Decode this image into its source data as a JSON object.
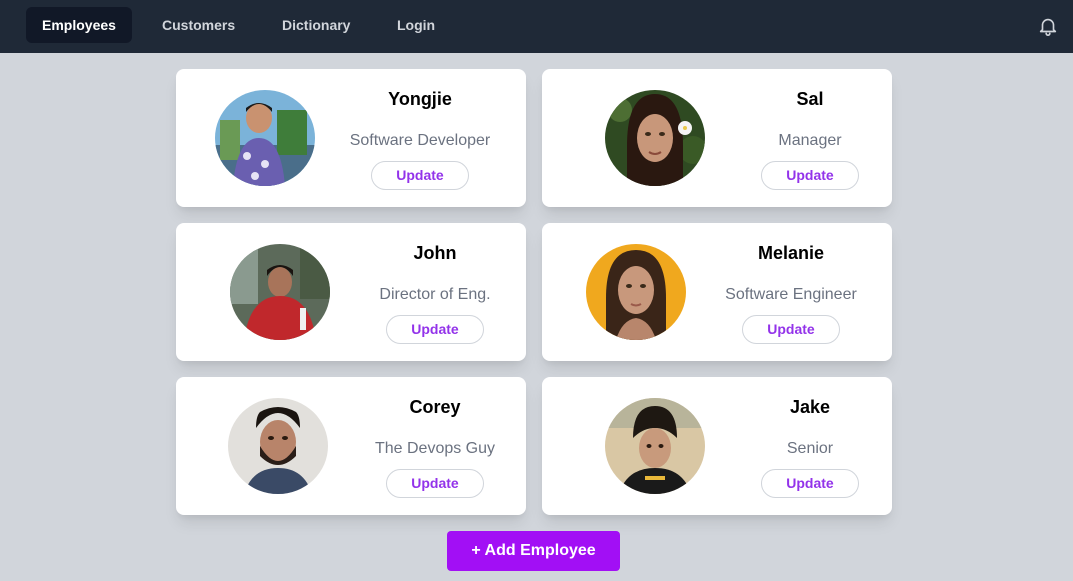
{
  "nav": {
    "items": [
      {
        "label": "Employees",
        "active": true
      },
      {
        "label": "Customers",
        "active": false
      },
      {
        "label": "Dictionary",
        "active": false
      },
      {
        "label": "Login",
        "active": false
      }
    ],
    "notification_icon": "bell-icon"
  },
  "employees": [
    {
      "name": "Yongjie",
      "title": "Software Developer",
      "update_label": "Update"
    },
    {
      "name": "Sal",
      "title": "Manager",
      "update_label": "Update"
    },
    {
      "name": "John",
      "title": "Director of Eng.",
      "update_label": "Update"
    },
    {
      "name": "Melanie",
      "title": "Software Engineer",
      "update_label": "Update"
    },
    {
      "name": "Corey",
      "title": "The Devops Guy",
      "update_label": "Update"
    },
    {
      "name": "Jake",
      "title": "Senior",
      "update_label": "Update"
    }
  ],
  "add_employee_label": "+ Add Employee",
  "colors": {
    "nav_bg": "#1f2937",
    "page_bg": "#d1d5db",
    "accent": "#a20ff5",
    "update_text": "#9333ea"
  }
}
